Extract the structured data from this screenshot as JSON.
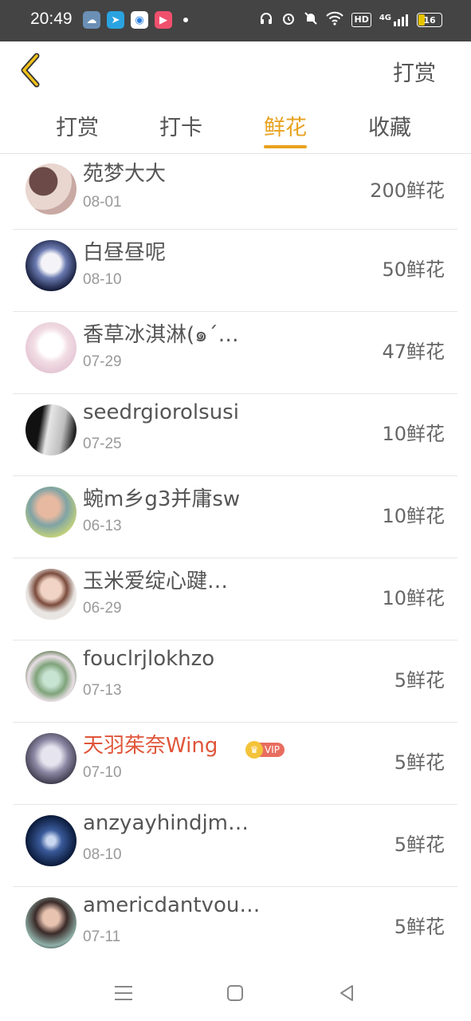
{
  "status_bar": {
    "time": "20:49",
    "network_badge": "HD",
    "signal_badge": "4G",
    "battery": "16"
  },
  "header": {
    "action_label": "打赏"
  },
  "tabs": [
    {
      "label": "打赏",
      "active": false
    },
    {
      "label": "打卡",
      "active": false
    },
    {
      "label": "鲜花",
      "active": true
    },
    {
      "label": "收藏",
      "active": false
    }
  ],
  "list": [
    {
      "name": "苑梦大大",
      "date": "08-01",
      "amount": "200鲜花",
      "vip": false
    },
    {
      "name": "白昼昼呢",
      "date": "08-10",
      "amount": "50鲜花",
      "vip": false
    },
    {
      "name": "香草冰淇淋(๑´…",
      "date": "07-29",
      "amount": "47鲜花",
      "vip": false
    },
    {
      "name": "seedrgiorolsusi",
      "date": "07-25",
      "amount": "10鲜花",
      "vip": false
    },
    {
      "name": "蜿m乡g3并庸sw",
      "date": "06-13",
      "amount": "10鲜花",
      "vip": false
    },
    {
      "name": "玉米爱绽心踺…",
      "date": "06-29",
      "amount": "10鲜花",
      "vip": false
    },
    {
      "name": "fouclrjlokhzo",
      "date": "07-13",
      "amount": "5鲜花",
      "vip": false
    },
    {
      "name": "天羽茱奈Wing",
      "date": "07-10",
      "amount": "5鲜花",
      "vip": true,
      "vip_label": "VIP"
    },
    {
      "name": "anzyayhindjm…",
      "date": "08-10",
      "amount": "5鲜花",
      "vip": false
    },
    {
      "name": "americdantvou…",
      "date": "07-11",
      "amount": "5鲜花",
      "vip": false
    }
  ],
  "colors": {
    "accent": "#e8a21e",
    "vip_name": "#e0553a"
  }
}
